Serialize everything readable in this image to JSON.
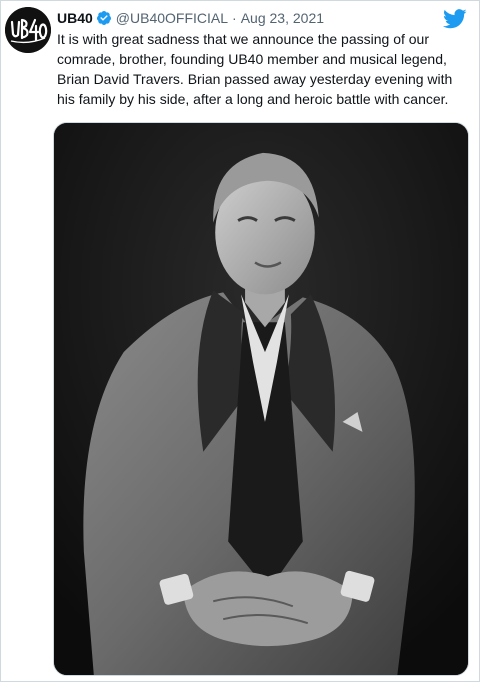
{
  "tweet": {
    "display_name": "UB40",
    "handle": "@UB40OFFICIAL",
    "separator": "·",
    "date": "Aug 23, 2021",
    "text": "It is with great sadness that we announce the passing of our comrade, brother, founding UB40 member and musical legend, Brian David Travers. Brian passed away yesterday evening with his family by his side, after a long and heroic battle with cancer.",
    "avatar_logo_text": "UB40",
    "verified_icon": "verified-badge-icon",
    "platform_icon": "twitter-bird-icon",
    "media": {
      "kind": "black-and-white portrait photo"
    }
  },
  "colors": {
    "verified": "#1d9bf0",
    "twitter_blue": "#1d9bf0",
    "secondary_text": "#536471",
    "border": "#cfd9de"
  }
}
